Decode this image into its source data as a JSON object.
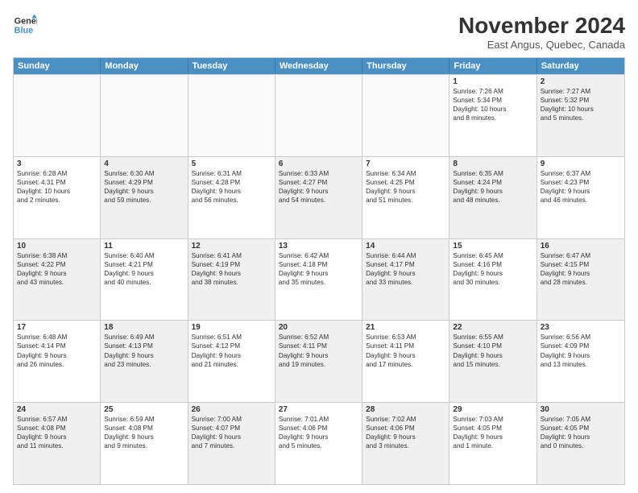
{
  "header": {
    "logo_line1": "General",
    "logo_line2": "Blue",
    "title": "November 2024",
    "location": "East Angus, Quebec, Canada"
  },
  "weekdays": [
    "Sunday",
    "Monday",
    "Tuesday",
    "Wednesday",
    "Thursday",
    "Friday",
    "Saturday"
  ],
  "rows": [
    [
      {
        "day": "",
        "info": "",
        "shaded": true,
        "empty": true
      },
      {
        "day": "",
        "info": "",
        "shaded": true,
        "empty": true
      },
      {
        "day": "",
        "info": "",
        "shaded": true,
        "empty": true
      },
      {
        "day": "",
        "info": "",
        "shaded": true,
        "empty": true
      },
      {
        "day": "",
        "info": "",
        "shaded": true,
        "empty": true
      },
      {
        "day": "1",
        "info": "Sunrise: 7:26 AM\nSunset: 5:34 PM\nDaylight: 10 hours\nand 8 minutes.",
        "shaded": false,
        "empty": false
      },
      {
        "day": "2",
        "info": "Sunrise: 7:27 AM\nSunset: 5:32 PM\nDaylight: 10 hours\nand 5 minutes.",
        "shaded": true,
        "empty": false
      }
    ],
    [
      {
        "day": "3",
        "info": "Sunrise: 6:28 AM\nSunset: 4:31 PM\nDaylight: 10 hours\nand 2 minutes.",
        "shaded": false,
        "empty": false
      },
      {
        "day": "4",
        "info": "Sunrise: 6:30 AM\nSunset: 4:29 PM\nDaylight: 9 hours\nand 59 minutes.",
        "shaded": true,
        "empty": false
      },
      {
        "day": "5",
        "info": "Sunrise: 6:31 AM\nSunset: 4:28 PM\nDaylight: 9 hours\nand 56 minutes.",
        "shaded": false,
        "empty": false
      },
      {
        "day": "6",
        "info": "Sunrise: 6:33 AM\nSunset: 4:27 PM\nDaylight: 9 hours\nand 54 minutes.",
        "shaded": true,
        "empty": false
      },
      {
        "day": "7",
        "info": "Sunrise: 6:34 AM\nSunset: 4:25 PM\nDaylight: 9 hours\nand 51 minutes.",
        "shaded": false,
        "empty": false
      },
      {
        "day": "8",
        "info": "Sunrise: 6:35 AM\nSunset: 4:24 PM\nDaylight: 9 hours\nand 48 minutes.",
        "shaded": true,
        "empty": false
      },
      {
        "day": "9",
        "info": "Sunrise: 6:37 AM\nSunset: 4:23 PM\nDaylight: 9 hours\nand 46 minutes.",
        "shaded": false,
        "empty": false
      }
    ],
    [
      {
        "day": "10",
        "info": "Sunrise: 6:38 AM\nSunset: 4:22 PM\nDaylight: 9 hours\nand 43 minutes.",
        "shaded": true,
        "empty": false
      },
      {
        "day": "11",
        "info": "Sunrise: 6:40 AM\nSunset: 4:21 PM\nDaylight: 9 hours\nand 40 minutes.",
        "shaded": false,
        "empty": false
      },
      {
        "day": "12",
        "info": "Sunrise: 6:41 AM\nSunset: 4:19 PM\nDaylight: 9 hours\nand 38 minutes.",
        "shaded": true,
        "empty": false
      },
      {
        "day": "13",
        "info": "Sunrise: 6:42 AM\nSunset: 4:18 PM\nDaylight: 9 hours\nand 35 minutes.",
        "shaded": false,
        "empty": false
      },
      {
        "day": "14",
        "info": "Sunrise: 6:44 AM\nSunset: 4:17 PM\nDaylight: 9 hours\nand 33 minutes.",
        "shaded": true,
        "empty": false
      },
      {
        "day": "15",
        "info": "Sunrise: 6:45 AM\nSunset: 4:16 PM\nDaylight: 9 hours\nand 30 minutes.",
        "shaded": false,
        "empty": false
      },
      {
        "day": "16",
        "info": "Sunrise: 6:47 AM\nSunset: 4:15 PM\nDaylight: 9 hours\nand 28 minutes.",
        "shaded": true,
        "empty": false
      }
    ],
    [
      {
        "day": "17",
        "info": "Sunrise: 6:48 AM\nSunset: 4:14 PM\nDaylight: 9 hours\nand 26 minutes.",
        "shaded": false,
        "empty": false
      },
      {
        "day": "18",
        "info": "Sunrise: 6:49 AM\nSunset: 4:13 PM\nDaylight: 9 hours\nand 23 minutes.",
        "shaded": true,
        "empty": false
      },
      {
        "day": "19",
        "info": "Sunrise: 6:51 AM\nSunset: 4:12 PM\nDaylight: 9 hours\nand 21 minutes.",
        "shaded": false,
        "empty": false
      },
      {
        "day": "20",
        "info": "Sunrise: 6:52 AM\nSunset: 4:11 PM\nDaylight: 9 hours\nand 19 minutes.",
        "shaded": true,
        "empty": false
      },
      {
        "day": "21",
        "info": "Sunrise: 6:53 AM\nSunset: 4:11 PM\nDaylight: 9 hours\nand 17 minutes.",
        "shaded": false,
        "empty": false
      },
      {
        "day": "22",
        "info": "Sunrise: 6:55 AM\nSunset: 4:10 PM\nDaylight: 9 hours\nand 15 minutes.",
        "shaded": true,
        "empty": false
      },
      {
        "day": "23",
        "info": "Sunrise: 6:56 AM\nSunset: 4:09 PM\nDaylight: 9 hours\nand 13 minutes.",
        "shaded": false,
        "empty": false
      }
    ],
    [
      {
        "day": "24",
        "info": "Sunrise: 6:57 AM\nSunset: 4:08 PM\nDaylight: 9 hours\nand 11 minutes.",
        "shaded": true,
        "empty": false
      },
      {
        "day": "25",
        "info": "Sunrise: 6:59 AM\nSunset: 4:08 PM\nDaylight: 9 hours\nand 9 minutes.",
        "shaded": false,
        "empty": false
      },
      {
        "day": "26",
        "info": "Sunrise: 7:00 AM\nSunset: 4:07 PM\nDaylight: 9 hours\nand 7 minutes.",
        "shaded": true,
        "empty": false
      },
      {
        "day": "27",
        "info": "Sunrise: 7:01 AM\nSunset: 4:06 PM\nDaylight: 9 hours\nand 5 minutes.",
        "shaded": false,
        "empty": false
      },
      {
        "day": "28",
        "info": "Sunrise: 7:02 AM\nSunset: 4:06 PM\nDaylight: 9 hours\nand 3 minutes.",
        "shaded": true,
        "empty": false
      },
      {
        "day": "29",
        "info": "Sunrise: 7:03 AM\nSunset: 4:05 PM\nDaylight: 9 hours\nand 1 minute.",
        "shaded": false,
        "empty": false
      },
      {
        "day": "30",
        "info": "Sunrise: 7:05 AM\nSunset: 4:05 PM\nDaylight: 9 hours\nand 0 minutes.",
        "shaded": true,
        "empty": false
      }
    ]
  ]
}
